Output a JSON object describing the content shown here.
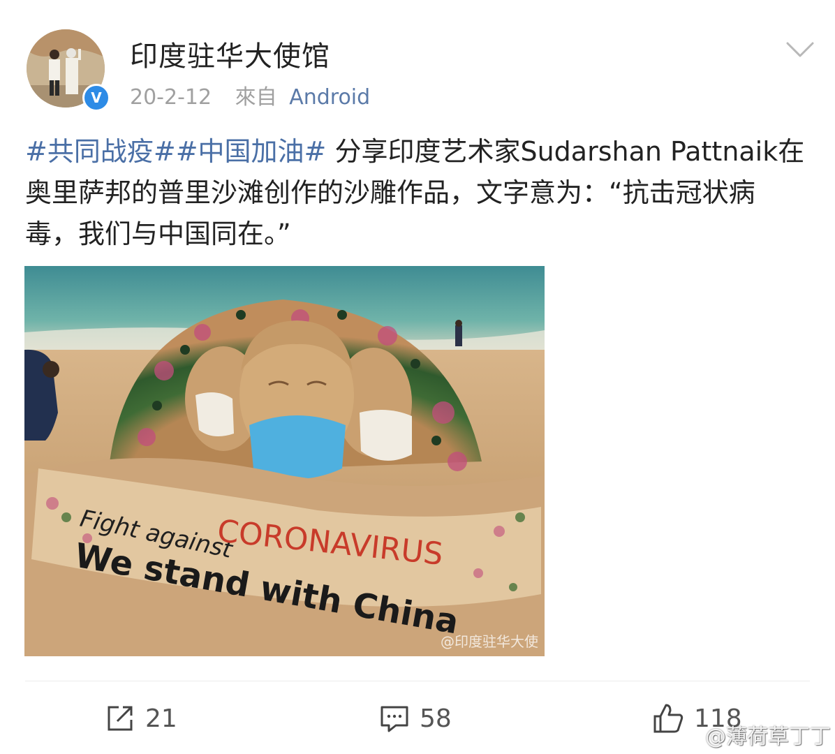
{
  "post": {
    "author": "印度驻华大使馆",
    "verified_mark": "V",
    "date": "20-2-12",
    "source_prefix": "來自",
    "source_device": "Android",
    "hashtags": [
      "#共同战疫#",
      "#中国加油#"
    ],
    "body": " 分享印度艺术家Sudarshan Pattnaik在奥里萨邦的普里沙滩创作的沙雕作品，文字意为：“抗击冠状病毒，我们与中国同在。”"
  },
  "image": {
    "line1_a": "Fight against",
    "line1_b": "CORONAVIRUS",
    "line2": "We stand with China",
    "watermark": "@印度驻华大使"
  },
  "actions": {
    "repost_count": "21",
    "comment_count": "58",
    "like_count": "118"
  },
  "overlay": {
    "watermark": "@薄荷草丁丁"
  },
  "colors": {
    "hashtag": "#4a6fa6",
    "source_device": "#5b7aa8",
    "verified_badge": "#2d8be6"
  },
  "icons": [
    "chevron-down-icon",
    "verified-icon",
    "repost-icon",
    "comment-icon",
    "like-icon"
  ]
}
